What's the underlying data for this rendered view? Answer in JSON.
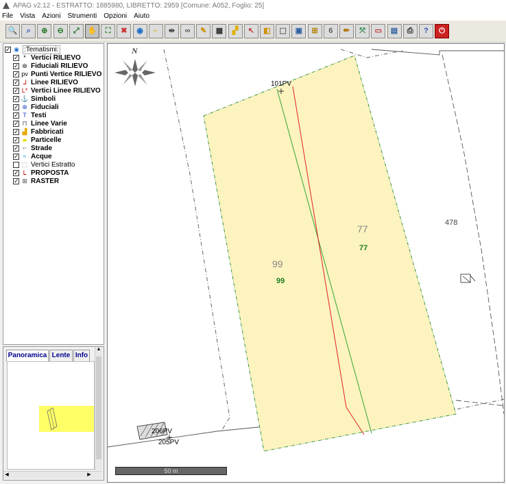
{
  "window": {
    "title": "APAG v2.12 - ESTRATTO: 1885980, LIBRETTO: 2959 [Comune: A052, Foglio: 25]"
  },
  "menu": [
    "File",
    "Vista",
    "Azioni",
    "Strumenti",
    "Opzioni",
    "Aiuto"
  ],
  "toolbar": [
    {
      "name": "zoom-search-icon",
      "glyph": "🔍",
      "color": "#4060c0"
    },
    {
      "name": "zoom-window-icon",
      "glyph": "⌕",
      "color": "#4060c0"
    },
    {
      "name": "zoom-in-icon",
      "glyph": "⊕",
      "color": "#2a7a2a"
    },
    {
      "name": "zoom-out-icon",
      "glyph": "⊖",
      "color": "#2a7a2a"
    },
    {
      "name": "zoom-extent-icon",
      "glyph": "⤢",
      "color": "#2a7a2a"
    },
    {
      "name": "pan-hand-icon",
      "glyph": "✋",
      "color": "#c08040",
      "pressed": true
    },
    {
      "name": "zoom-fit-icon",
      "glyph": "⛶",
      "color": "#2a8a2a"
    },
    {
      "name": "zoom-center-icon",
      "glyph": "✖",
      "color": "#cc3333"
    },
    {
      "name": "globe-icon",
      "glyph": "◉",
      "color": "#1e6ec8"
    },
    {
      "name": "angle-icon",
      "glyph": "⌐",
      "color": "#d8b800"
    },
    {
      "name": "measure-icon",
      "glyph": "⇹",
      "color": "#444444"
    },
    {
      "name": "link-icon",
      "glyph": "∞",
      "color": "#555555"
    },
    {
      "name": "edit-icon",
      "glyph": "✎",
      "color": "#c89000"
    },
    {
      "name": "grid-icon",
      "glyph": "▦",
      "color": "#333333"
    },
    {
      "name": "fill-icon",
      "glyph": "▞",
      "color": "#e0b000"
    },
    {
      "name": "pointer-icon",
      "glyph": "↖",
      "color": "#c03030"
    },
    {
      "name": "layer-icon",
      "glyph": "◧",
      "color": "#d09000"
    },
    {
      "name": "select-icon",
      "glyph": "⬚",
      "color": "#333333"
    },
    {
      "name": "save-icon",
      "glyph": "▣",
      "color": "#3060a0"
    },
    {
      "name": "ruler-icon",
      "glyph": "⊞",
      "color": "#b08000"
    },
    {
      "name": "count-icon",
      "glyph": "6",
      "color": "#606060"
    },
    {
      "name": "pencil-icon",
      "glyph": "✏",
      "color": "#b07000"
    },
    {
      "name": "transform-icon",
      "glyph": "⤧",
      "color": "#208040"
    },
    {
      "name": "window-icon",
      "glyph": "▭",
      "color": "#c03030"
    },
    {
      "name": "disk-icon",
      "glyph": "▤",
      "color": "#3060a0"
    },
    {
      "name": "print-icon",
      "glyph": "⎙",
      "color": "#222222"
    },
    {
      "name": "help-icon",
      "glyph": "?",
      "color": "#3050b0"
    },
    {
      "name": "power-icon",
      "glyph": "⏻",
      "color": "#ffffff",
      "bg": "#cc2222"
    }
  ],
  "layers": {
    "root": ":Tematismi:",
    "items": [
      {
        "label": "Vertici RILIEVO",
        "icon": "*",
        "color": "#000000",
        "bold": true
      },
      {
        "label": "Fiduciali RILIEVO",
        "icon": "⊛",
        "color": "#000000",
        "bold": true
      },
      {
        "label": "Punti Vertice RILIEVO",
        "icon": "pv",
        "color": "#000000",
        "bold": true
      },
      {
        "label": "Linee RILIEVO",
        "icon": "ᒧ",
        "color": "#cc0000",
        "bold": true
      },
      {
        "label": "Vertici Linee RILIEVO",
        "icon": "L*",
        "color": "#cc0000",
        "bold": true
      },
      {
        "label": "Simboli",
        "icon": "⚓",
        "color": "#2040c0",
        "bold": true
      },
      {
        "label": "Fiduciali",
        "icon": "⊕",
        "color": "#2040c0",
        "bold": true
      },
      {
        "label": "Testi",
        "icon": "T",
        "color": "#2040c0",
        "bold": true
      },
      {
        "label": "Linee Varie",
        "icon": "⊓",
        "color": "#444444",
        "bold": true
      },
      {
        "label": "Fabbricati",
        "icon": "▟",
        "color": "#e6a800",
        "bold": true
      },
      {
        "label": "Particelle",
        "icon": "▰",
        "color": "#e8e000",
        "bold": true
      },
      {
        "label": "Strade",
        "icon": "⇐",
        "color": "#aaaaaa",
        "bold": true
      },
      {
        "label": "Acque",
        "icon": "≈",
        "color": "#30a0e0",
        "bold": true
      },
      {
        "label": "Vertici Estratto",
        "icon": "⬚",
        "color": "#888888",
        "bold": false,
        "unchecked": true
      },
      {
        "label": "PROPOSTA",
        "icon": "ᒪ",
        "color": "#cc0000",
        "bold": true
      },
      {
        "label": "RASTER",
        "icon": "⊞",
        "color": "#444444",
        "bold": true
      }
    ]
  },
  "overview_tabs": [
    "Panoramica",
    "Lente",
    "Info"
  ],
  "map": {
    "north_label": "N",
    "parcel_fill": "#fcf3bf",
    "labels": {
      "p99_gray": "99",
      "p99_green": "99",
      "p77_gray": "77",
      "p77_green": "77",
      "p478": "478",
      "pt101": "101PV",
      "pt206": "206PV",
      "pt205": "205PV",
      "scale": "50 m"
    }
  }
}
